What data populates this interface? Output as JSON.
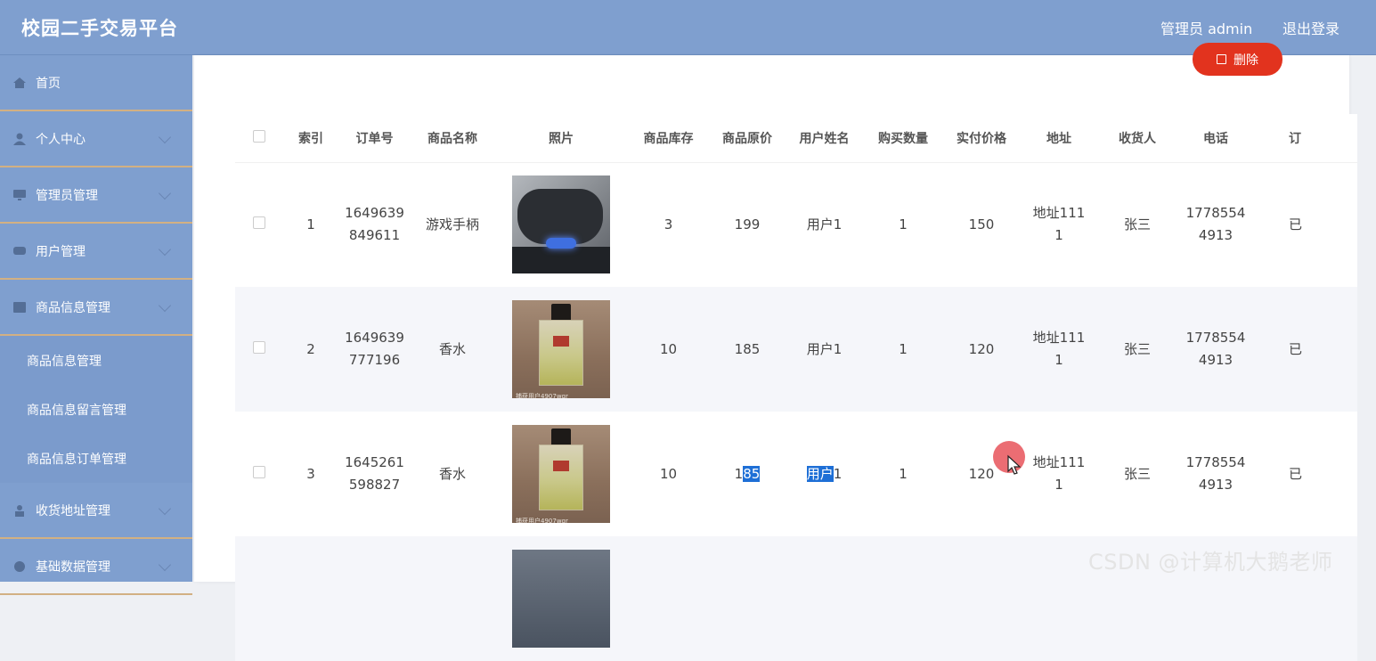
{
  "header": {
    "brand": "校园二手交易平台",
    "user": "管理员 admin",
    "logout": "退出登录"
  },
  "sidebar": {
    "items": [
      {
        "label": "首页",
        "icon": "home-icon"
      },
      {
        "label": "个人中心",
        "icon": "person-icon"
      },
      {
        "label": "管理员管理",
        "icon": "monitor-icon"
      },
      {
        "label": "用户管理",
        "icon": "user-group-icon"
      },
      {
        "label": "商品信息管理",
        "icon": "box-icon"
      }
    ],
    "sub_items": [
      "商品信息管理",
      "商品信息留言管理",
      "商品信息订单管理"
    ],
    "items_after": [
      {
        "label": "收货地址管理",
        "icon": "address-icon"
      },
      {
        "label": "基础数据管理",
        "icon": "data-icon"
      }
    ]
  },
  "toolbar": {
    "delete_label": "删除"
  },
  "table": {
    "headers": [
      "索引",
      "订单号",
      "商品名称",
      "照片",
      "商品库存",
      "商品原价",
      "用户姓名",
      "购买数量",
      "实付价格",
      "地址",
      "收货人",
      "电话",
      "订"
    ],
    "rows": [
      {
        "index": "1",
        "order_line1": "1649639",
        "order_line2": "849611",
        "name": "游戏手柄",
        "photo": "gamepad",
        "stock": "3",
        "price": "199",
        "user": "用户1",
        "qty": "1",
        "paid": "150",
        "addr_line1": "地址111",
        "addr_line2": "1",
        "receiver": "张三",
        "phone_line1": "1778554",
        "phone_line2": "4913",
        "trunc": "已"
      },
      {
        "index": "2",
        "order_line1": "1649639",
        "order_line2": "777196",
        "name": "香水",
        "photo": "perfume",
        "stock": "10",
        "price": "185",
        "user": "用户1",
        "qty": "1",
        "paid": "120",
        "addr_line1": "地址111",
        "addr_line2": "1",
        "receiver": "张三",
        "phone_line1": "1778554",
        "phone_line2": "4913",
        "trunc": "已"
      },
      {
        "index": "3",
        "order_line1": "1645261",
        "order_line2": "598827",
        "name": "香水",
        "photo": "perfume",
        "stock": "10",
        "price_a": "1",
        "price_b": "85",
        "user_a": "用户",
        "user_b": "1",
        "qty": "1",
        "paid": "120",
        "addr_line1": "地址111",
        "addr_line2": "1",
        "receiver": "张三",
        "phone_line1": "1778554",
        "phone_line2": "4913",
        "trunc": "已"
      }
    ],
    "photo_watermark": "捕获用户4907wgr"
  },
  "watermark": "CSDN @计算机大鹅老师",
  "colors": {
    "header_bg": "#7f9fcf",
    "delete_btn": "#e2331e",
    "selection": "#1e6fd6",
    "menu_divider": "#d2b083"
  }
}
